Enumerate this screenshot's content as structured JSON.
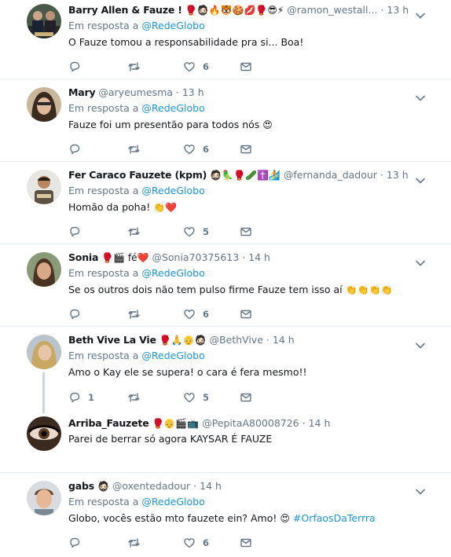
{
  "tweets": [
    {
      "name": "Barry Allen & Fauze !",
      "name_emoji": "🥊🧔🏻🔥🐯🍪💋🥊😎⚡",
      "handle": "@ramon_westall...",
      "time": "13 h",
      "reply_prefix": "Em resposta a",
      "reply_to": "@RedeGlobo",
      "text": "O Fauze tomou a responsabilidade pra si... Boa!",
      "replies": "",
      "retweets": "",
      "likes": "6"
    },
    {
      "name": "Mary",
      "name_emoji": "",
      "handle": "@aryeumesma",
      "time": "13 h",
      "reply_prefix": "Em resposta a",
      "reply_to": "@RedeGlobo",
      "text": "Fauze foi um presentão para todos nós",
      "text_emoji": "😍",
      "replies": "",
      "retweets": "",
      "likes": "6"
    },
    {
      "name": "Fer Caraco Fauzete (kpm)",
      "name_emoji": "🧔🏻🦜🥊🥒✝️🏄",
      "handle": "@fernanda_dadour",
      "time": "13 h",
      "reply_prefix": "Em resposta a",
      "reply_to": "@RedeGlobo",
      "text": "Homão da poha!",
      "text_emoji": "👏❤️",
      "replies": "",
      "retweets": "",
      "likes": "5"
    },
    {
      "name": "Sonia",
      "name_emoji": "🥊🎬 fé❤️",
      "handle": "@Sonia70375613",
      "time": "14 h",
      "reply_prefix": "Em resposta a",
      "reply_to": "@RedeGlobo",
      "text": "Se os outros dois não tem pulso firme Fauze tem isso aí",
      "text_emoji": "👏👏👏👏",
      "replies": "",
      "retweets": "",
      "likes": "6"
    },
    {
      "name": "Beth Vive La Vie",
      "name_emoji": "🥊🙏👴🧔🏻",
      "handle": "@BethVive",
      "time": "14 h",
      "reply_prefix": "Em resposta a",
      "reply_to": "@RedeGlobo",
      "text": "Amo o Kay ele se supera! o cara é fera mesmo!!",
      "replies": "1",
      "retweets": "",
      "likes": "5"
    },
    {
      "name": "Arriba_Fauzete",
      "name_emoji": "🥊👴🎬📺",
      "handle": "@PepitaA80008726",
      "time": "14 h",
      "text": "Parei de berrar só agora KAYSAR É FAUZE"
    },
    {
      "name": "gabs",
      "name_emoji": "🧔🏻",
      "handle": "@oxentedadour",
      "time": "14 h",
      "reply_prefix": "Em resposta a",
      "reply_to": "@RedeGlobo",
      "text": "Globo, vocês estão mto fauzete ein? Amo!",
      "text_emoji": "😍",
      "hashtag": "#OrfaosDaTerrra",
      "replies": "",
      "retweets": "",
      "likes": "6"
    }
  ],
  "separator": "·",
  "colors": {
    "accent": "#1b95e0",
    "secondary_text": "#657786",
    "border": "#e6ecf0",
    "thread_line": "#ccd6dd"
  },
  "icons": [
    "reply-icon",
    "retweet-icon",
    "like-icon",
    "message-icon",
    "chevron-down-icon"
  ]
}
